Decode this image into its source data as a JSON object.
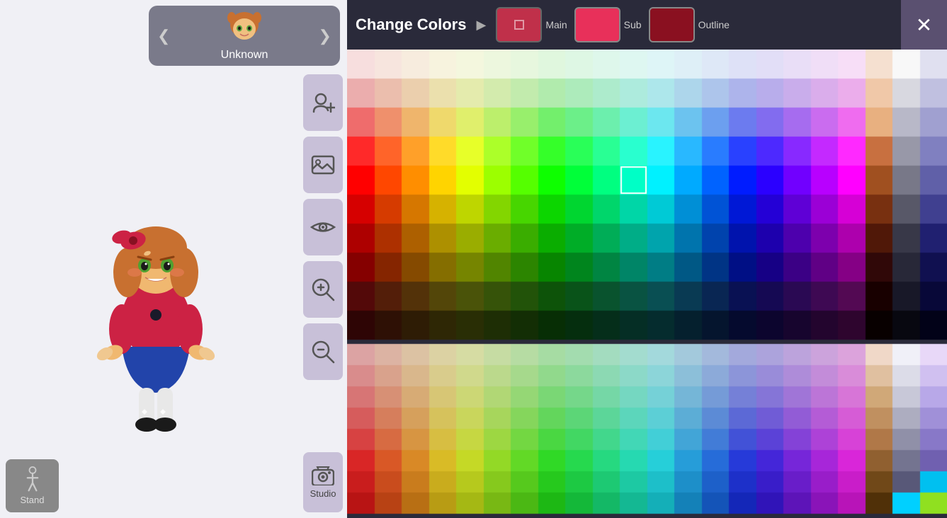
{
  "character": {
    "name": "Unknown",
    "avatar_emoji": "👧"
  },
  "header": {
    "change_colors_label": "Change Colors",
    "arrow": "▶",
    "main_label": "Main",
    "sub_label": "Sub",
    "outline_label": "Outline",
    "main_color": "#c0304a",
    "sub_color": "#e8305a",
    "outline_color": "#8a1020",
    "close_label": "✕",
    "selected_color": "#e8305a"
  },
  "toolbar": {
    "add_character_icon": "👤+",
    "image_icon": "🖼",
    "eye_icon": "👁",
    "zoom_in_icon": "🔍+",
    "zoom_out_icon": "🔍-",
    "studio_label": "Studio",
    "studio_icon": "📷",
    "stand_label": "Stand"
  },
  "color_grid": {
    "rows": 13,
    "cols": 22,
    "cell_size": 38,
    "selected_row": 4,
    "selected_col": 10
  }
}
